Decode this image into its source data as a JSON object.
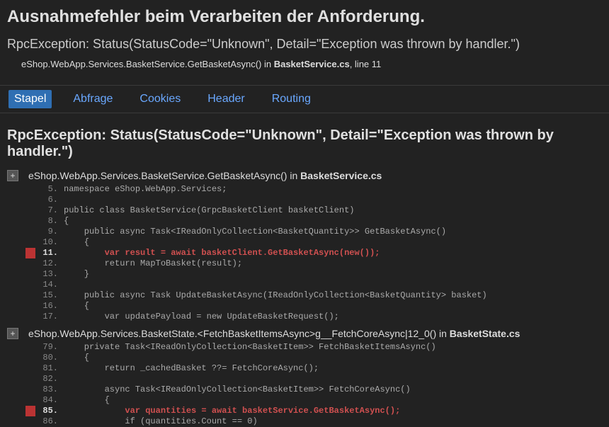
{
  "title": "Ausnahmefehler beim Verarbeiten der Anforderung.",
  "exception_summary": "RpcException: Status(StatusCode=\"Unknown\", Detail=\"Exception was thrown by handler.\")",
  "top_frame": {
    "method": "eShop.WebApp.Services.BasketService.GetBasketAsync() in ",
    "file": "BasketService.cs",
    "line_suffix": ", line 11"
  },
  "tabs": [
    {
      "label": "Stapel",
      "active": true
    },
    {
      "label": "Abfrage",
      "active": false
    },
    {
      "label": "Cookies",
      "active": false
    },
    {
      "label": "Header",
      "active": false
    },
    {
      "label": "Routing",
      "active": false
    }
  ],
  "exception_header": "RpcException: Status(StatusCode=\"Unknown\", Detail=\"Exception was thrown by handler.\")",
  "frames": [
    {
      "method": "eShop.WebApp.Services.BasketService.GetBasketAsync() in ",
      "file": "BasketService.cs",
      "expand": "+",
      "lines": [
        {
          "no": "5.",
          "code": "namespace eShop.WebApp.Services;",
          "hl": false
        },
        {
          "no": "6.",
          "code": "",
          "hl": false
        },
        {
          "no": "7.",
          "code": "public class BasketService(GrpcBasketClient basketClient)",
          "hl": false
        },
        {
          "no": "8.",
          "code": "{",
          "hl": false
        },
        {
          "no": "9.",
          "code": "    public async Task<IReadOnlyCollection<BasketQuantity>> GetBasketAsync()",
          "hl": false
        },
        {
          "no": "10.",
          "code": "    {",
          "hl": false
        },
        {
          "no": "11.",
          "code": "        var result = await basketClient.GetBasketAsync(new());",
          "hl": true
        },
        {
          "no": "12.",
          "code": "        return MapToBasket(result);",
          "hl": false
        },
        {
          "no": "13.",
          "code": "    }",
          "hl": false
        },
        {
          "no": "14.",
          "code": "",
          "hl": false
        },
        {
          "no": "15.",
          "code": "    public async Task UpdateBasketAsync(IReadOnlyCollection<BasketQuantity> basket)",
          "hl": false
        },
        {
          "no": "16.",
          "code": "    {",
          "hl": false
        },
        {
          "no": "17.",
          "code": "        var updatePayload = new UpdateBasketRequest();",
          "hl": false
        }
      ]
    },
    {
      "method": "eShop.WebApp.Services.BasketState.<FetchBasketItemsAsync>g__FetchCoreAsync|12_0() in ",
      "file": "BasketState.cs",
      "expand": "+",
      "lines": [
        {
          "no": "79.",
          "code": "    private Task<IReadOnlyCollection<BasketItem>> FetchBasketItemsAsync()",
          "hl": false
        },
        {
          "no": "80.",
          "code": "    {",
          "hl": false
        },
        {
          "no": "81.",
          "code": "        return _cachedBasket ??= FetchCoreAsync();",
          "hl": false
        },
        {
          "no": "82.",
          "code": "",
          "hl": false
        },
        {
          "no": "83.",
          "code": "        async Task<IReadOnlyCollection<BasketItem>> FetchCoreAsync()",
          "hl": false
        },
        {
          "no": "84.",
          "code": "        {",
          "hl": false
        },
        {
          "no": "85.",
          "code": "            var quantities = await basketService.GetBasketAsync();",
          "hl": true
        },
        {
          "no": "86.",
          "code": "            if (quantities.Count == 0)",
          "hl": false
        }
      ]
    }
  ]
}
